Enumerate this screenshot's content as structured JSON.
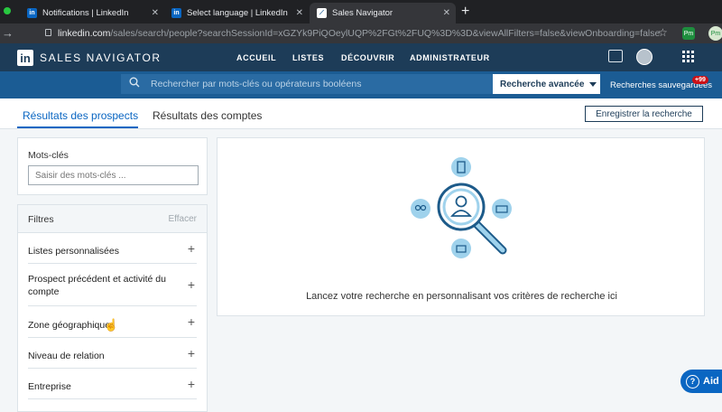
{
  "browser": {
    "tabs": [
      {
        "title": "Notifications | LinkedIn"
      },
      {
        "title": "Select language | LinkedIn"
      },
      {
        "title": "Sales Navigator"
      }
    ],
    "url_domain": "linkedin.com",
    "url_path": "/sales/search/people?searchSessionId=xGZYk9PiQOeylUQP%2FGt%2FUQ%3D%3D&viewAllFilters=false&viewOnboarding=false"
  },
  "header": {
    "logo_in": "in",
    "logo_text": "SALES NAVIGATOR",
    "nav": [
      "ACCUEIL",
      "LISTES",
      "DÉCOUVRIR",
      "ADMINISTRATEUR"
    ]
  },
  "search": {
    "placeholder": "Rechercher par mots-clés ou opérateurs booléens",
    "advanced_label": "Recherche avancée",
    "saved_label": "Recherches sauvegardées",
    "saved_badge": "+99"
  },
  "page_tabs": {
    "prospects": "Résultats des prospects",
    "accounts": "Résultats des comptes",
    "save_button": "Enregistrer la recherche"
  },
  "keywords": {
    "title": "Mots-clés",
    "placeholder": "Saisir des mots-clés ..."
  },
  "filters": {
    "title": "Filtres",
    "clear": "Effacer",
    "items": [
      {
        "label": "Listes personnalisées"
      },
      {
        "label": "Prospect précédent et activité du compte"
      },
      {
        "label": "Zone géographique"
      },
      {
        "label": "Niveau de relation"
      },
      {
        "label": "Entreprise"
      }
    ]
  },
  "main": {
    "prompt": "Lancez votre recherche en personnalisant vos critères de recherche ici"
  },
  "help": {
    "label": "Aid"
  },
  "colors": {
    "header": "#1d3c58",
    "search_band": "#1b5c94",
    "accent": "#0a66c2",
    "illustration_light": "#9fd2ec",
    "illustration_dark": "#1d5b8a"
  }
}
